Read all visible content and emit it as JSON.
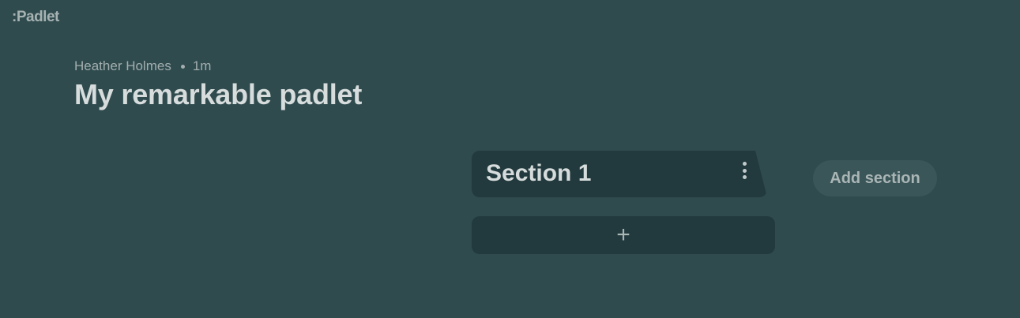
{
  "brand": {
    "logo": ":Padlet"
  },
  "header": {
    "author": "Heather Holmes",
    "time": "1m",
    "title": "My remarkable padlet"
  },
  "board": {
    "section": {
      "title": "Section 1",
      "menu_icon": "kebab-menu-icon"
    },
    "add_post": {
      "icon": "plus-icon",
      "glyph": "+"
    },
    "add_section_label": "Add section"
  },
  "colors": {
    "background": "#2f4b4e",
    "card": "#223a3d",
    "button": "#3b5659",
    "text_primary": "#d7dcdc",
    "text_secondary": "#a3aeae"
  }
}
